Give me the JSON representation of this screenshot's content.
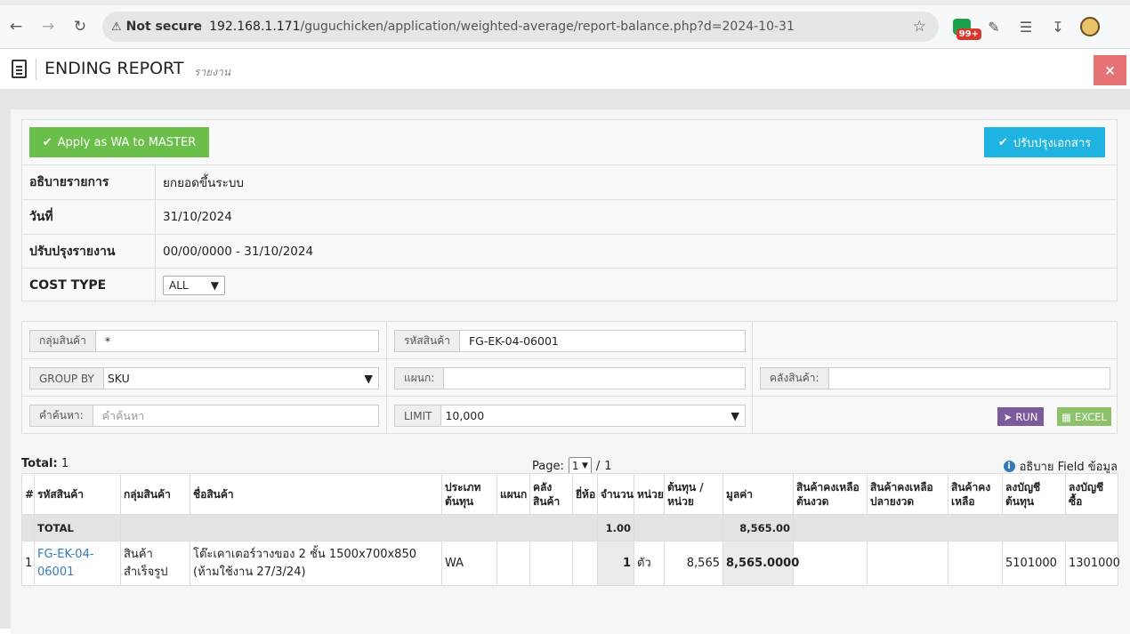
{
  "browser": {
    "security_label": "Not secure",
    "url_host": "192.168.1.171",
    "url_path": "/guguchicken/application/weighted-average/report-balance.php?d=2024-10-31",
    "ext_badge": "99+"
  },
  "header": {
    "title": "ENDING REPORT",
    "subtitle": "รายงาน",
    "close_label": "×"
  },
  "actions": {
    "apply_label": "Apply as WA to MASTER",
    "update_label": "ปรับปรุงเอกสาร"
  },
  "info": [
    {
      "key": "อธิบายรายการ",
      "value": "ยกยอดขึ้นระบบ"
    },
    {
      "key": "วันที่",
      "value": "31/10/2024"
    },
    {
      "key": "ปรับปรุงรายงาน",
      "value": "00/00/0000 - 31/10/2024"
    },
    {
      "key": "COST TYPE",
      "value": "ALL"
    }
  ],
  "filters": {
    "group_label": "กลุ่มสินค้า",
    "group_value": "*",
    "sku_label": "รหัสสินค้า",
    "sku_value": "FG-EK-04-06001",
    "groupby_label": "GROUP BY",
    "groupby_value": "SKU",
    "dept_label": "แผนก:",
    "dept_value": "",
    "warehouse_label": "คลังสินค้า:",
    "warehouse_value": "",
    "search_label": "คำค้นหา:",
    "search_placeholder": "คำค้นหา",
    "limit_label": "LIMIT",
    "limit_value": "10,000",
    "run_label": "RUN",
    "excel_label": "EXCEL"
  },
  "summary": {
    "total_label": "Total:",
    "total_value": "1",
    "page_label": "Page:",
    "page_current": "1",
    "page_sep": "/",
    "page_total": "1",
    "field_help": "อธิบาย Field ข้อมูล"
  },
  "table": {
    "headers": [
      "#",
      "รหัสสินค้า",
      "กลุ่มสินค้า",
      "ชื่อสินค้า",
      "ประเภทต้นทุน",
      "แผนก",
      "คลังสินค้า",
      "ยี่ห้อ",
      "จำนวน",
      "หน่วย",
      "ต้นทุน / หน่วย",
      "มูลค่า",
      "สินค้าคงเหลือต้นงวด",
      "สินค้าคงเหลือปลายงวด",
      "สินค้าคงเหลือ",
      "ลงบัญชีต้นทุน",
      "ลงบัญชีซื้อ"
    ],
    "total_row": {
      "label": "TOTAL",
      "qty": "1.00",
      "value": "8,565.00"
    },
    "rows": [
      {
        "no": "1",
        "sku": "FG-EK-04-06001",
        "group": "สินค้าสำเร็จรูป",
        "name": "โต๊ะเคาเตอร์วางของ 2 ชั้น 1500x700x850 (ห้ามใช้งาน 27/3/24)",
        "cost_type": "WA",
        "dept": "",
        "warehouse": "",
        "brand": "",
        "qty": "1",
        "unit": "ตัว",
        "unit_cost": "8,565",
        "value": "8,565.0000",
        "begin": "",
        "end": "",
        "remain": "",
        "acc_cost": "5101000",
        "acc_buy": "1301000"
      }
    ]
  }
}
